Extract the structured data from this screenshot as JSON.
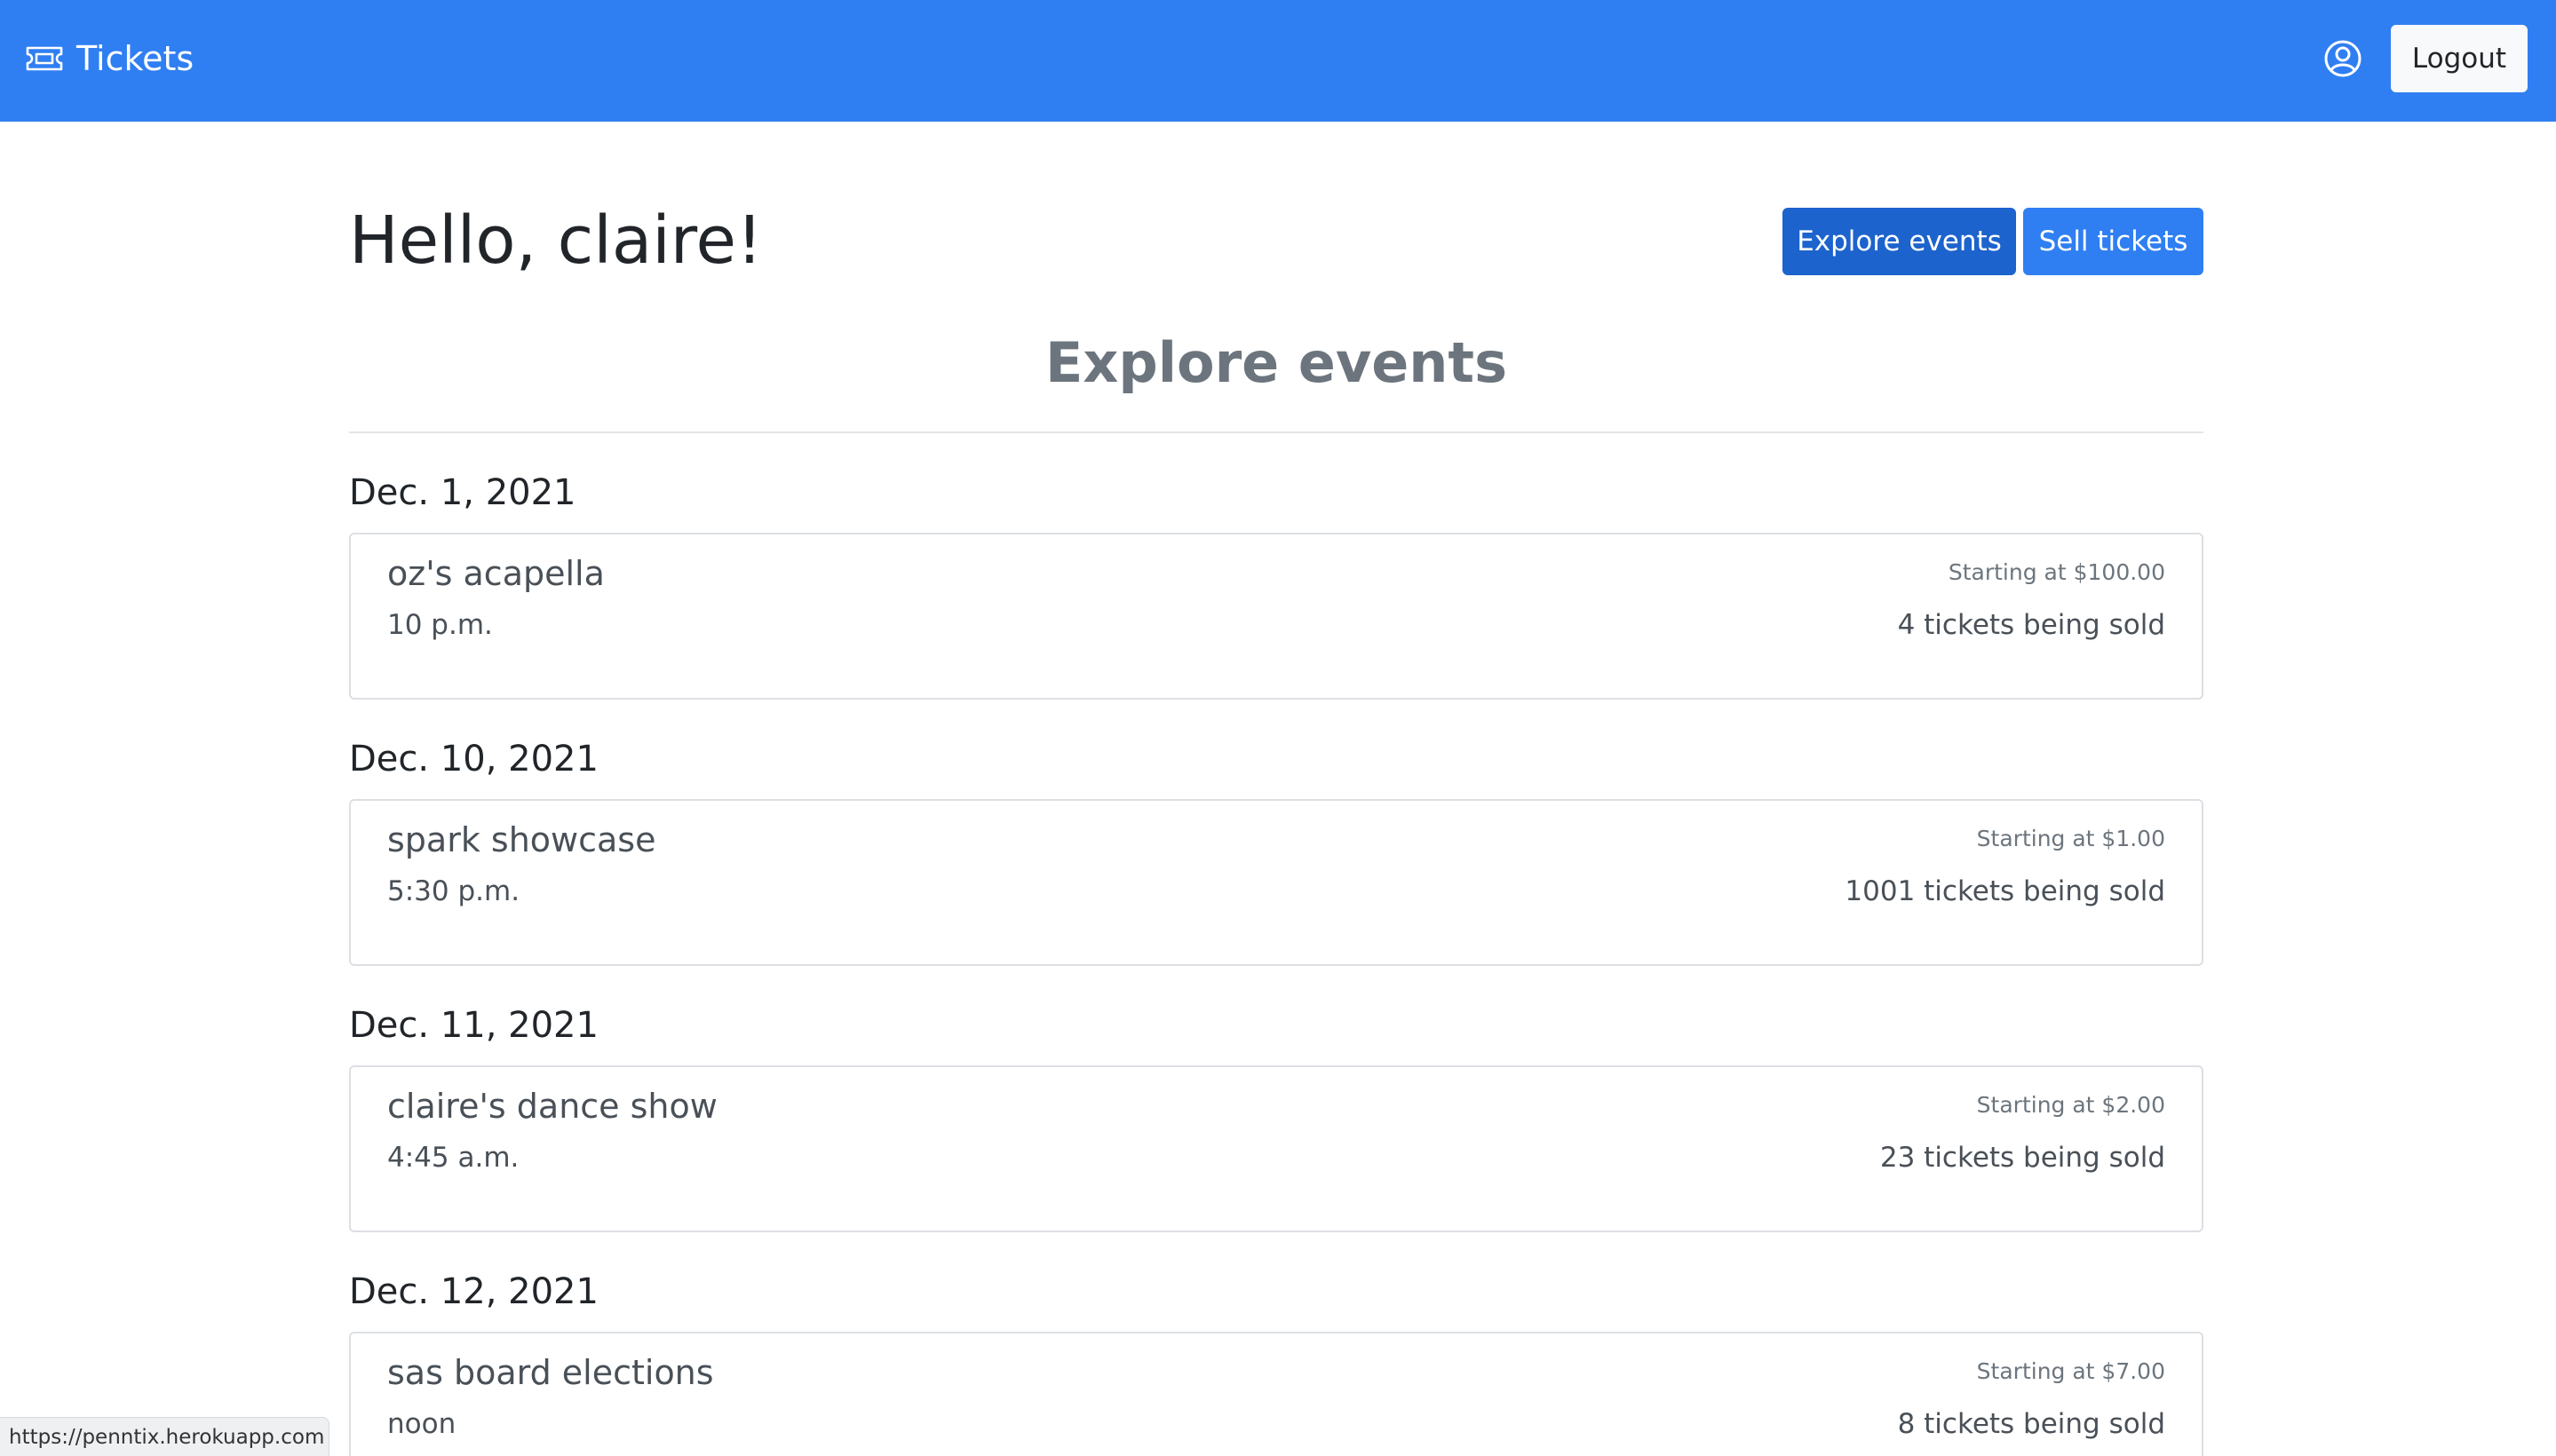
{
  "navbar": {
    "brand": "Tickets",
    "logout_label": "Logout",
    "brand_icon": "ticket-icon",
    "user_icon": "user-circle-icon",
    "bg_color": "#2f7ff2"
  },
  "header": {
    "greeting": "Hello, claire!",
    "explore_label": "Explore events",
    "sell_label": "Sell tickets"
  },
  "section": {
    "title": "Explore events"
  },
  "events": [
    {
      "date": "Dec. 1, 2021",
      "name": "oz's acapella",
      "time": "10 p.m.",
      "price": "Starting at $100.00",
      "count": "4 tickets being sold"
    },
    {
      "date": "Dec. 10, 2021",
      "name": "spark showcase",
      "time": "5:30 p.m.",
      "price": "Starting at $1.00",
      "count": "1001 tickets being sold"
    },
    {
      "date": "Dec. 11, 2021",
      "name": "claire's dance show",
      "time": "4:45 a.m.",
      "price": "Starting at $2.00",
      "count": "23 tickets being sold"
    },
    {
      "date": "Dec. 12, 2021",
      "name": "sas board elections",
      "time": "noon",
      "price": "Starting at $7.00",
      "count": "8 tickets being sold"
    }
  ],
  "status_bar": {
    "url": "https://penntix.herokuapp.com"
  }
}
